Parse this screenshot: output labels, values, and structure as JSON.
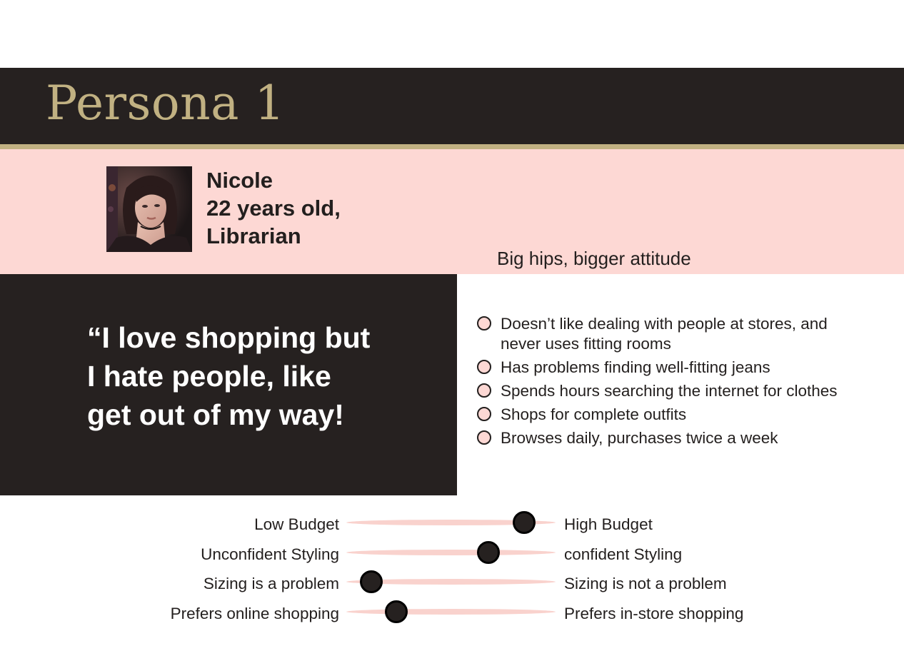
{
  "header": {
    "title": "Persona 1"
  },
  "profile": {
    "avatar_icon": "portrait-photo",
    "name": "Nicole",
    "age": "22 years old,",
    "occupation": "Librarian",
    "tagline": "Big hips, bigger attitude"
  },
  "quote": {
    "lines": [
      "“I love shopping but",
      "I hate people, like",
      "get out of my way!"
    ]
  },
  "traits": [
    {
      "line1": "Doesn’t like dealing with people at stores, and",
      "line2": "never uses fitting rooms"
    },
    {
      "line1": "Has problems finding well-fitting jeans"
    },
    {
      "line1": "Spends hours searching the internet for clothes"
    },
    {
      "line1": "Shops for complete outfits"
    },
    {
      "line1": "Browses daily, purchases twice a week"
    }
  ],
  "scales": [
    {
      "left": "Low Budget",
      "right": "High Budget",
      "value": 0.85
    },
    {
      "left": "Unconfident Styling",
      "right": "confident Styling",
      "value": 0.68
    },
    {
      "left": "Sizing is a problem",
      "right": "Sizing is not a problem",
      "value": 0.12
    },
    {
      "left": "Prefers online shopping",
      "right": "Prefers in-store shopping",
      "value": 0.24
    }
  ],
  "colors": {
    "dark": "#262120",
    "gold": "#c1b182",
    "pink": "#fdd8d4"
  }
}
